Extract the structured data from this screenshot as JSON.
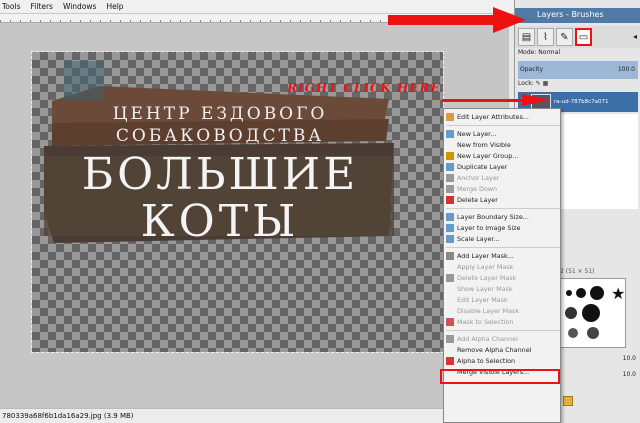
{
  "menubar": {
    "items": [
      "Tools",
      "Filters",
      "Windows",
      "Help"
    ]
  },
  "dock": {
    "title": "Layers - Brushes",
    "mode_label": "Mode: Normal",
    "opacity_label": "Opacity",
    "opacity_value": "100.0",
    "lock_label": "Lock:",
    "layer_name": "ra-ud-787b8c7a071",
    "brush_label": "2 (51 × 51)",
    "brush_value": "10.0",
    "brush_value2": "10.0"
  },
  "statusbar": {
    "text": "780339a68f6b1da16a29.jpg (3.9 MB)"
  },
  "annotation": {
    "right_click_text": "RIGHT CLICK HERE",
    "color": "#e11111"
  },
  "sign": {
    "line1": "ЦЕНТР ЕЗДОВОГО",
    "line2": "СОБАКОВОДСТВА",
    "line3": "БОЛЬШИЕ",
    "line4": "КОТЫ"
  },
  "context_menu": {
    "items": [
      {
        "label": "Edit Layer Attributes...",
        "disabled": false,
        "icon": "edit-icon"
      },
      {
        "label": "New Layer...",
        "disabled": false,
        "icon": "new-layer-icon"
      },
      {
        "label": "New from Visible",
        "disabled": false,
        "icon": ""
      },
      {
        "label": "New Layer Group...",
        "disabled": false,
        "icon": "folder-icon"
      },
      {
        "label": "Duplicate Layer",
        "disabled": false,
        "icon": "duplicate-icon"
      },
      {
        "label": "Anchor Layer",
        "disabled": true,
        "icon": "anchor-icon"
      },
      {
        "label": "Merge Down",
        "disabled": true,
        "icon": "merge-icon"
      },
      {
        "label": "Delete Layer",
        "disabled": false,
        "icon": "delete-icon"
      },
      {
        "label": "Layer Boundary Size...",
        "disabled": false,
        "icon": "boundary-icon"
      },
      {
        "label": "Layer to Image Size",
        "disabled": false,
        "icon": "to-image-icon"
      },
      {
        "label": "Scale Layer...",
        "disabled": false,
        "icon": "scale-icon"
      },
      {
        "label": "Add Layer Mask...",
        "disabled": false,
        "icon": "mask-icon"
      },
      {
        "label": "Apply Layer Mask",
        "disabled": true,
        "icon": ""
      },
      {
        "label": "Delete Layer Mask",
        "disabled": true,
        "icon": "trash-icon"
      },
      {
        "label": "Show Layer Mask",
        "disabled": true,
        "icon": ""
      },
      {
        "label": "Edit Layer Mask",
        "disabled": true,
        "icon": ""
      },
      {
        "label": "Disable Layer Mask",
        "disabled": true,
        "icon": ""
      },
      {
        "label": "Mask to Selection",
        "disabled": true,
        "icon": "mask-sel-icon"
      },
      {
        "label": "Add Alpha Channel",
        "disabled": true,
        "icon": "alpha-icon"
      },
      {
        "label": "Remove Alpha Channel",
        "disabled": false,
        "icon": ""
      },
      {
        "label": "Alpha to Selection",
        "disabled": false,
        "icon": "alpha-sel-icon"
      },
      {
        "label": "Merge Visible Layers...",
        "disabled": false,
        "icon": ""
      }
    ]
  }
}
